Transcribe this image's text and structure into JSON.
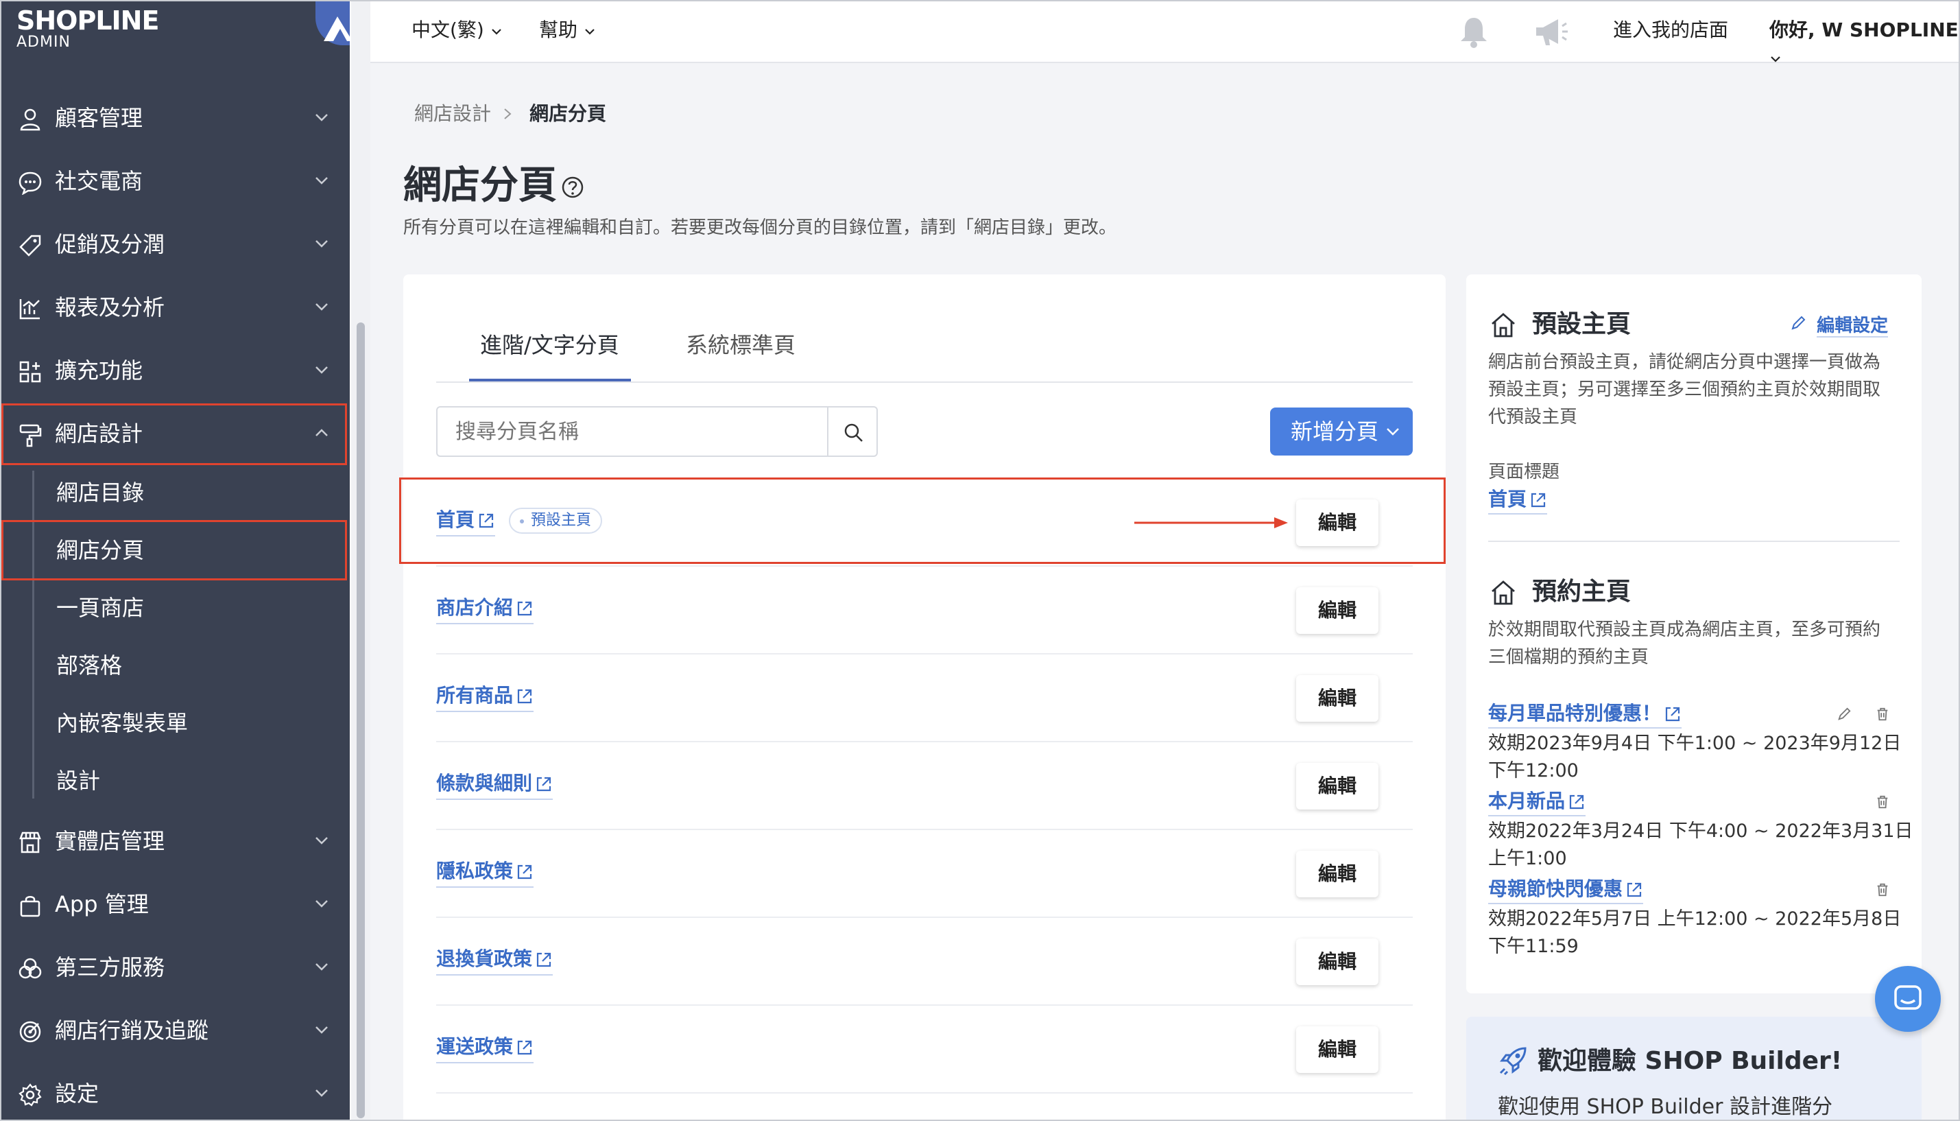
{
  "sidebar": {
    "logo_main": "SHOPLINE",
    "logo_sub": "ADMIN",
    "items": [
      {
        "label": "顧客管理",
        "icon": "user-icon"
      },
      {
        "label": "社交電商",
        "icon": "chat-bubble-icon"
      },
      {
        "label": "促銷及分潤",
        "icon": "tag-icon"
      },
      {
        "label": "報表及分析",
        "icon": "chart-icon"
      },
      {
        "label": "擴充功能",
        "icon": "apps-icon"
      },
      {
        "label": "網店設計",
        "icon": "paint-roller-icon"
      },
      {
        "label": "實體店管理",
        "icon": "store-icon"
      },
      {
        "label": "App 管理",
        "icon": "bag-icon"
      },
      {
        "label": "第三方服務",
        "icon": "circles-icon"
      },
      {
        "label": "網店行銷及追蹤",
        "icon": "target-icon"
      },
      {
        "label": "設定",
        "icon": "gear-icon"
      }
    ],
    "sub_items": [
      "網店目錄",
      "網店分頁",
      "一頁商店",
      "部落格",
      "內嵌客製表單",
      "設計"
    ]
  },
  "topbar": {
    "language": "中文(繁)",
    "help": "幫助",
    "visit_store": "進入我的店面",
    "greeting": "你好, W SHOPLINE"
  },
  "breadcrumb": {
    "parent": "網店設計",
    "current": "網店分頁"
  },
  "page": {
    "title": "網店分頁",
    "description": "所有分頁可以在這裡編輯和自訂。若要更改每個分頁的目錄位置，請到「網店目錄」更改。"
  },
  "tabs": {
    "advanced": "進階/文字分頁",
    "system": "系統標準頁"
  },
  "search": {
    "placeholder": "搜尋分頁名稱"
  },
  "add_button": "新增分頁",
  "pages": [
    {
      "name": "首頁",
      "badge": "預設主頁",
      "edit": "編輯"
    },
    {
      "name": "商店介紹",
      "edit": "編輯"
    },
    {
      "name": "所有商品",
      "edit": "編輯"
    },
    {
      "name": "條款與細則",
      "edit": "編輯"
    },
    {
      "name": "隱私政策",
      "edit": "編輯"
    },
    {
      "name": "退換貨政策",
      "edit": "編輯"
    },
    {
      "name": "運送政策",
      "edit": "編輯"
    }
  ],
  "default_home": {
    "title": "預設主頁",
    "edit_settings": "編輯設定",
    "description_lines": [
      "網店前台預設主頁，請從網店分頁中選擇一頁做為",
      "預設主頁；另可選擇至多三個預約主頁於效期間取",
      "代預設主頁"
    ],
    "page_title_label": "頁面標題",
    "page_title_value": "首頁"
  },
  "scheduled_home": {
    "title": "預約主頁",
    "description_lines": [
      "於效期間取代預設主頁成為網店主頁，至多可預約",
      "三個檔期的預約主頁"
    ],
    "items": [
      {
        "name": "每月單品特別優惠！",
        "period_line1": "效期2023年9月4日 下午1:00 ~ 2023年9月12日",
        "period_line2": "下午12:00"
      },
      {
        "name": "本月新品",
        "period_line1": "效期2022年3月24日 下午4:00 ~ 2022年3月31日",
        "period_line2": "上午1:00"
      },
      {
        "name": "母親節快閃優惠",
        "period_line1": "效期2022年5月7日 上午12:00 ~ 2022年5月8日",
        "period_line2": "下午11:59"
      }
    ]
  },
  "builder": {
    "title": "歡迎體驗 SHOP Builder!",
    "text": "歡迎使用 SHOP Builder 設計進階分"
  },
  "colors": {
    "sidebar_bg": "#3a4152",
    "accent": "#4a7fe0",
    "highlight": "#e0432e",
    "link": "#3a6cc6"
  }
}
